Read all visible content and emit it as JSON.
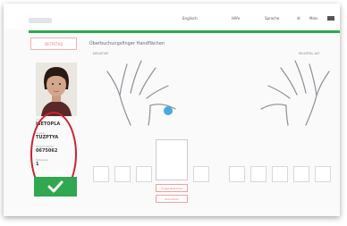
{
  "topbar": {
    "items": [
      "Englisch",
      "Hilfe",
      "Sprache",
      "di",
      "Mein"
    ]
  },
  "sidebar": {
    "detail_button": "DETAYTAŞ",
    "fields": [
      {
        "label": "Adı",
        "value": "ISETOPLA"
      },
      {
        "label": "Soyadı",
        "value": "TUZPTYA"
      },
      {
        "label": "Doğum Tarihi",
        "value": "0675062"
      },
      {
        "label": "Referans",
        "value": "1"
      }
    ]
  },
  "main": {
    "title": "Überbuchungsfinger Handflächen",
    "left_hand_label": "NEGATIVE",
    "right_hand_label": "MULTIPAL ALT",
    "scan_buttons": [
      "Fingerabdrücke",
      "Aufnahme"
    ]
  }
}
